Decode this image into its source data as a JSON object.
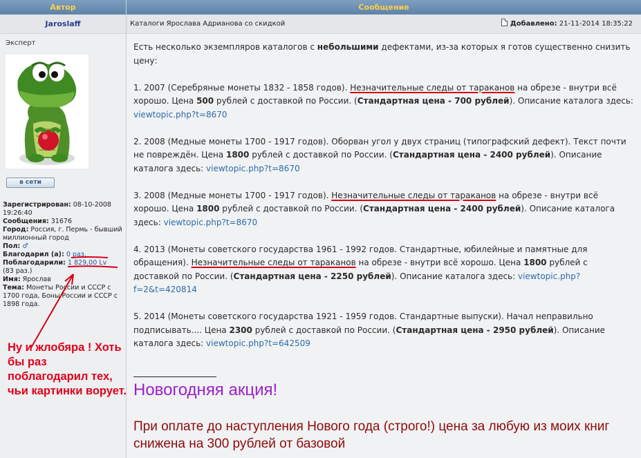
{
  "header": {
    "author_col": "Автор",
    "message_col": "Сообщение"
  },
  "author": {
    "name": "Jaroslaff",
    "rank": "Эксперт",
    "status_button": "в сети",
    "profile": {
      "registered_label": "Зарегистрирован:",
      "registered_value": "08-10-2008 19:26:40",
      "posts_label": "Сообщения:",
      "posts_value": "31676",
      "city_label": "Город:",
      "city_value": "Россия, г. Пермь - бывший миллионный город",
      "gender_label": "Пол:",
      "thanked_label": "Благодарил (а):",
      "thanked_value": "0 раз.",
      "was_thanked_label": "Поблагодарили:",
      "was_thanked_value": "1 829,00 Lv",
      "was_thanked_extra": "(83 раз.)",
      "name_label": "Имя:",
      "name_value": "Ярослав",
      "topic_label": "Тема:",
      "topic_value": "Монеты России и СССР с 1700 года, Боны России и СССР с 1898 года."
    }
  },
  "annotation": {
    "text": "Ну и жлобяра ! Хоть бы раз поблагодарил тех, чьи картинки ворует.",
    "color": "#e0001b"
  },
  "post": {
    "subject": "Каталоги Ярослава Адрианова со скидкой",
    "posted_label": "Добавлено:",
    "posted_value": "21-11-2014 18:35:22",
    "intro_pre": "Есть несколько экземпляров каталогов с ",
    "intro_bold": "небольшими",
    "intro_post": " дефектами, из-за которых я готов существенно снизить цену:",
    "item1": {
      "pre": "1. 2007 (Серебряные монеты 1832 - 1858 годов). ",
      "defect": "Незначительные следы от тараканов",
      "mid": " на обрезе - внутри всё хорошо. Цена ",
      "price": "500",
      "after_price": " рублей с доставкой по России. (",
      "std": "Стандартная цена - 700 рублей",
      "after_std": "). Описание каталога здесь: ",
      "link": "viewtopic.php?t=8670"
    },
    "item2": {
      "pre": "2. 2008 (Медные монеты 1700 - 1917 годов). Оборван угол у двух страниц (типографский дефект). Текст почти не повреждён. Цена ",
      "price": "1800",
      "after_price": " рублей с доставкой по России. (",
      "std": "Стандартная цена - 2400 рублей",
      "after_std": "). Описание каталога здесь: ",
      "link": "viewtopic.php?t=8670"
    },
    "item3": {
      "pre": "3. 2008 (Медные монеты 1700 - 1917 годов). ",
      "defect": "Незначительные следы от тараканов",
      "mid": " на обрезе - внутри всё хорошо. Цена ",
      "price": "1800",
      "after_price": " рублей с доставкой по России. (",
      "std": "Стандартная цена - 2400 рублей",
      "after_std": "). Описание каталога здесь: ",
      "link": "viewtopic.php?t=8670"
    },
    "item4": {
      "pre": "4. 2013 (Монеты советского государства 1961 - 1992 годов. Стандартные, юбилейные и памятные для обращения). ",
      "defect": "Незначительные следы от тараканов",
      "mid": " на обрезе - внутри всё хорошо. Цена ",
      "price": "1800",
      "after_price": " рублей с доставкой по России. (",
      "std": "Стандартная цена - 2250 рублей",
      "after_std": "). Описание каталога здесь: ",
      "link": "viewtopic.php?f=2&t=420814"
    },
    "item5": {
      "pre": "5. 2014 (Монеты советского государства 1921 - 1959 годов. Стандартные выпуски). Начал неправильно подписывать.... Цена ",
      "price": "2300",
      "after_price": " рублей с доставкой по России. (",
      "std": "Стандартная цена - 2950 рублей",
      "after_std": "). Описание каталога здесь: ",
      "link": "viewtopic.php?t=642509"
    },
    "promo_title": "Новогодняя акция!",
    "promo_text": "При оплате до наступления Нового года (строго!) цена за любую из моих книг снижена на 300 рублей от базовой"
  },
  "colors": {
    "header_text": "#ffcf4a",
    "header_bg": "#5d83ab",
    "link": "#2e6ca8",
    "promo_title": "#9b1fc9",
    "promo_text": "#8b0a0a",
    "markup_red": "#d40018"
  }
}
